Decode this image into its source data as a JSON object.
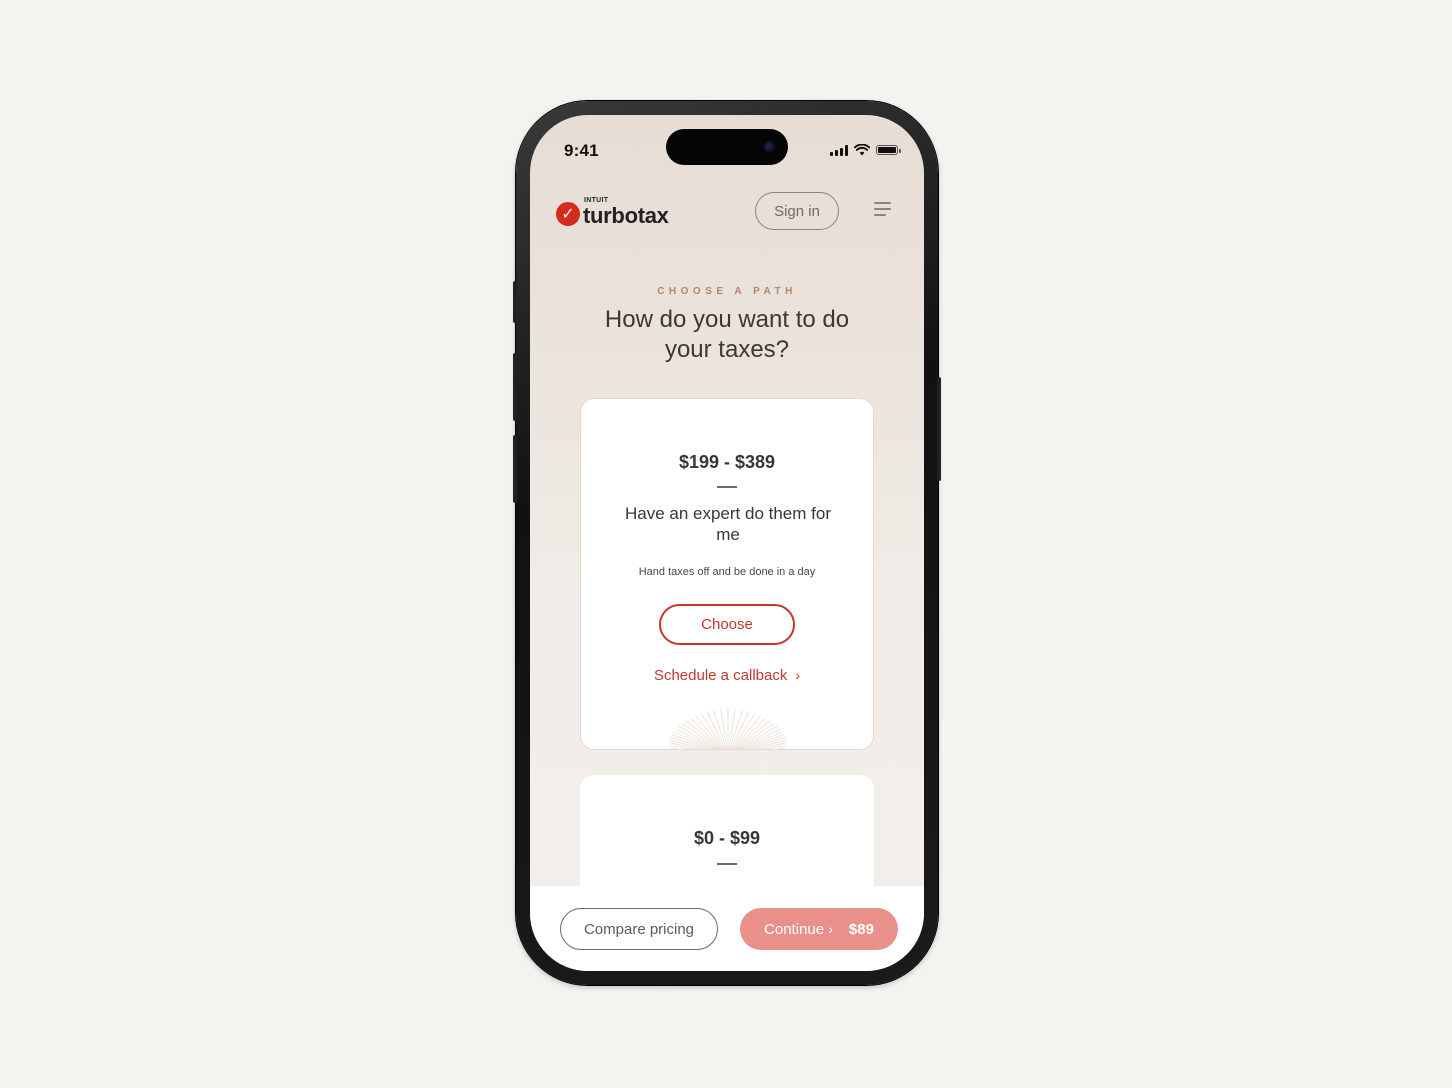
{
  "status_bar": {
    "time": "9:41"
  },
  "header": {
    "brand_small": "INTUIT",
    "brand_name": "turbotax",
    "brand_color": "#d52b1e",
    "sign_in_label": "Sign in",
    "menu_icon": "hamburger-menu-icon"
  },
  "hero": {
    "eyebrow": "CHOOSE A PATH",
    "headline": "How do you want to do your taxes?"
  },
  "cards": [
    {
      "price": "$199 - $389",
      "title": "Have an expert do them for me",
      "description": "Hand taxes off and be done in a day",
      "choose_label": "Choose",
      "callback_label": "Schedule a callback"
    },
    {
      "price": "$0 - $99"
    }
  ],
  "bottom_bar": {
    "compare_label": "Compare pricing",
    "continue_label": "Continue",
    "continue_price": "$89",
    "accent_color": "#c4372b",
    "continue_color": "#e9908a"
  }
}
